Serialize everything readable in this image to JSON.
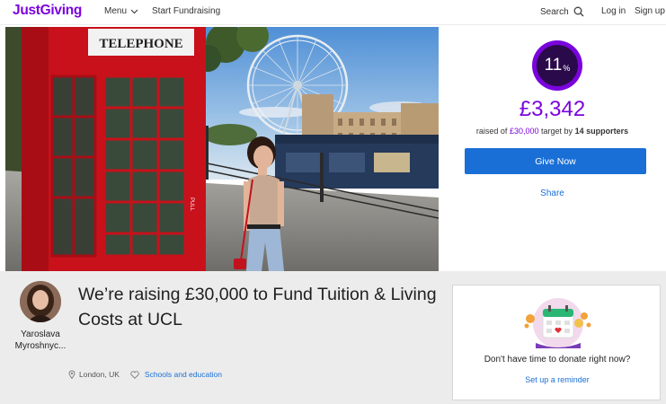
{
  "header": {
    "logo": "JustGiving",
    "menu_label": "Menu",
    "start_label": "Start Fundraising",
    "search_label": "Search",
    "login_label": "Log in",
    "signup_label": "Sign up"
  },
  "hero": {
    "booth_sign": "TELEPHONE",
    "booth_door_sign": "PULL"
  },
  "panel": {
    "percent": "11",
    "percent_symbol": "%",
    "progress_fraction": 0.11,
    "amount_raised": "£3,342",
    "raised_prefix": "raised of",
    "target": "£30,000",
    "target_mid": "target by",
    "supporters": "14 supporters",
    "give_label": "Give Now",
    "share_label": "Share"
  },
  "page": {
    "title": "We’re raising £30,000 to Fund Tuition & Living Costs at UCL",
    "owner_first": "Yaroslava",
    "owner_last": "Myroshnyc...",
    "location": "London, UK",
    "category": "Schools and education"
  },
  "reminder": {
    "question": "Don't have time to donate right now?",
    "link_label": "Set up a reminder"
  },
  "colors": {
    "brand_purple": "#7a04dd",
    "button_blue": "#1a6fd6",
    "lower_bg": "#ececec"
  },
  "icons": {
    "menu_chevron": "chevron-down-icon",
    "search": "search-icon",
    "location": "location-pin-icon",
    "category": "heart-icon",
    "reminder": "calendar-icon"
  }
}
